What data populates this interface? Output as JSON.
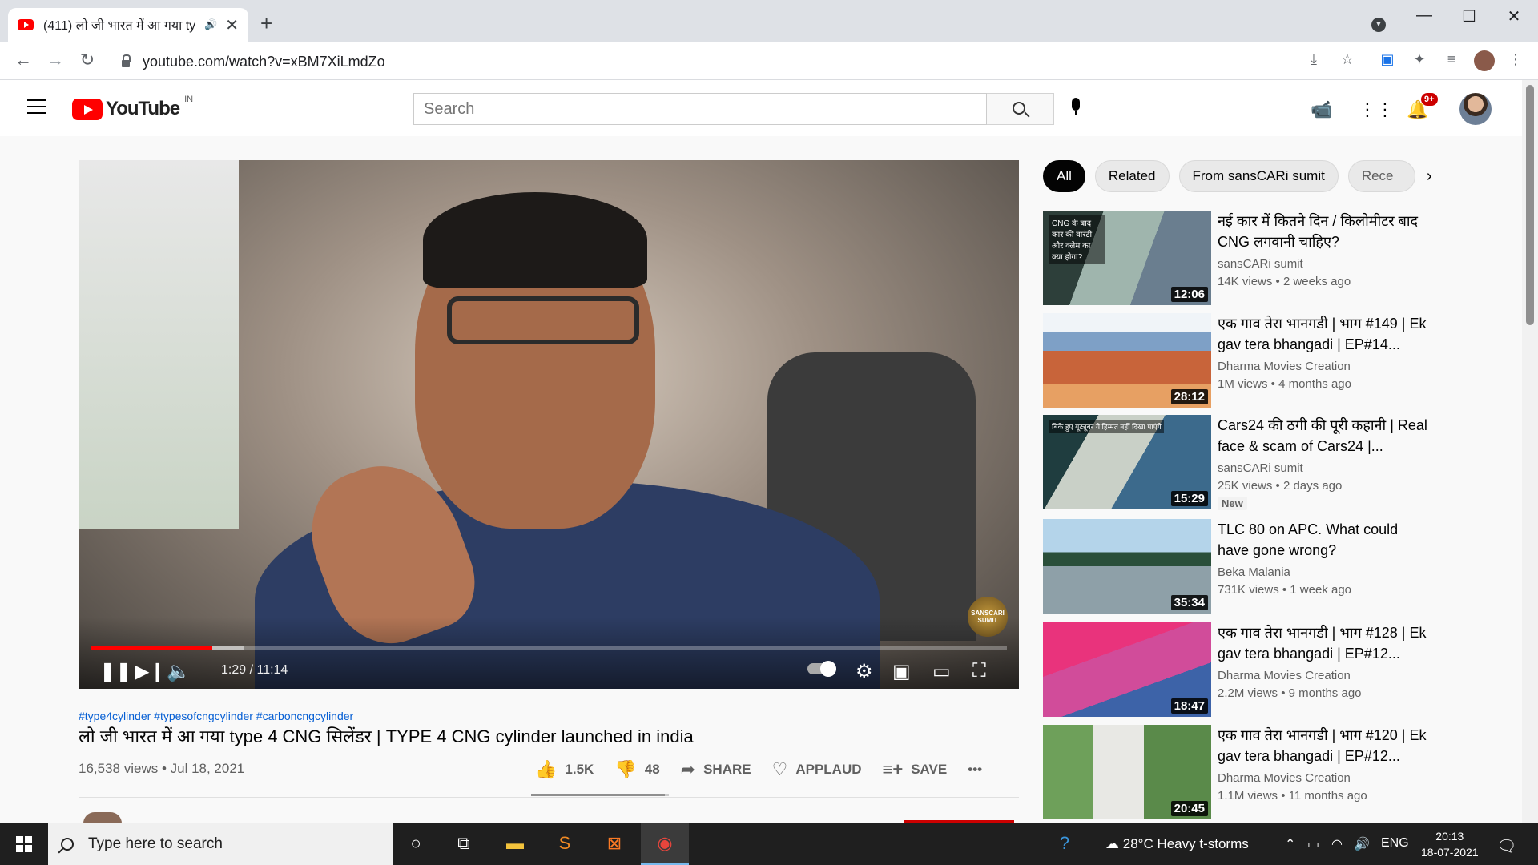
{
  "browser": {
    "tab_title": "(411) लो जी भारत में आ गया ty",
    "tab_close": "✕",
    "new_tab": "+",
    "url": "youtube.com/watch?v=xBM7XiLmdZo",
    "window_controls": {
      "minimize": "—",
      "maximize": "☐",
      "close": "✕"
    }
  },
  "youtube": {
    "logo_text": "YouTube",
    "country_code": "IN",
    "search_placeholder": "Search",
    "notification_count": "9+"
  },
  "player": {
    "current_time": "1:29",
    "duration": "11:14",
    "time_display": "1:29 / 11:14",
    "played_fraction": 0.133,
    "buffered_fraction": 0.168,
    "watermark": "SANSCARI SUMIT"
  },
  "video": {
    "hashtags": "#type4cylinder #typesofcngcylinder #carboncngcylinder",
    "title": "लो जी भारत में आ गया type 4 CNG सिलेंडर | TYPE 4 CNG cylinder launched in india",
    "views_date": "16,538 views • Jul 18, 2021",
    "likes": "1.5K",
    "dislikes": "48",
    "like_fraction": 0.969,
    "share_label": "SHARE",
    "applaud_label": "APPLAUD",
    "save_label": "SAVE",
    "more_label": "•••"
  },
  "chips": [
    "All",
    "Related",
    "From sansCARi sumit",
    "Rece"
  ],
  "recommendations": [
    {
      "title": "नई कार में कितने दिन / किलोमीटर बाद CNG लगवानी चाहिए?",
      "channel": "sansCARi sumit",
      "views": "14K views • 2 weeks ago",
      "duration": "12:06",
      "overlay": "CNG के बाद कार की वारंटी और क्लेम का क्या होगा?"
    },
    {
      "title": "एक गाव तेरा भानगडी | भाग #149 | Ek gav tera bhangadi | EP#14...",
      "channel": "Dharma Movies Creation",
      "views": "1M views • 4 months ago",
      "duration": "28:12",
      "overlay": ""
    },
    {
      "title": "Cars24 की ठगी की पूरी कहानी | Real face & scam of Cars24 |...",
      "channel": "sansCARi sumit",
      "views": "25K views • 2 days ago",
      "duration": "15:29",
      "overlay": "बिके हुए यूट्यूबर ये हिम्मत नहीं दिखा पाएंगे",
      "badge": "New"
    },
    {
      "title": "TLC 80 on APC. What could have gone wrong?",
      "channel": "Beka Malania",
      "views": "731K views • 1 week ago",
      "duration": "35:34",
      "overlay": ""
    },
    {
      "title": "एक गाव तेरा भानगडी | भाग #128 | Ek gav tera bhangadi | EP#12...",
      "channel": "Dharma Movies Creation",
      "views": "2.2M views • 9 months ago",
      "duration": "18:47",
      "overlay": ""
    },
    {
      "title": "एक गाव तेरा भानगडी | भाग #120 | Ek gav tera bhangadi | EP#12...",
      "channel": "Dharma Movies Creation",
      "views": "1.1M views • 11 months ago",
      "duration": "20:45",
      "overlay": ""
    }
  ],
  "taskbar": {
    "search_placeholder": "Type here to search",
    "weather": "28°C  Heavy t-storms",
    "language": "ENG",
    "time": "20:13",
    "date": "18-07-2021"
  }
}
